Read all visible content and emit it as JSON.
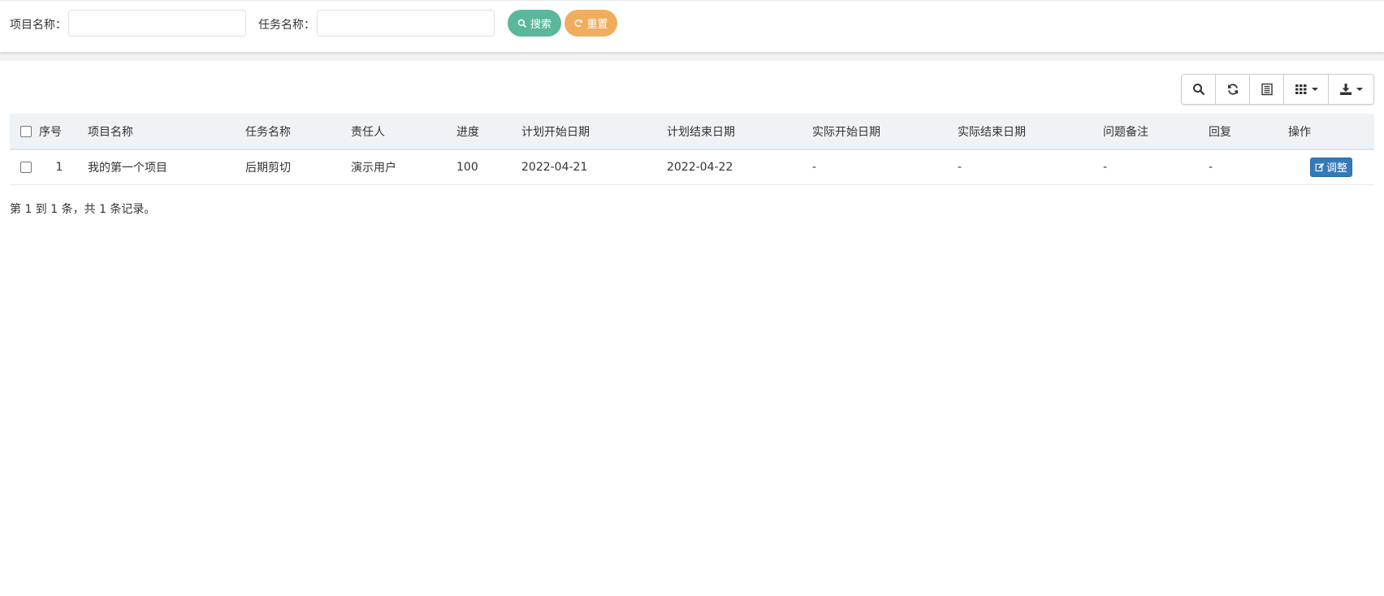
{
  "search": {
    "project_label": "项目名称：",
    "project_value": "",
    "task_label": "任务名称：",
    "task_value": "",
    "search_button": "搜索",
    "reset_button": "重置"
  },
  "toolbar": {
    "icons": [
      "search-icon",
      "refresh-icon",
      "toggle-view-icon",
      "columns-icon",
      "export-icon"
    ]
  },
  "table": {
    "headers": {
      "seq": "序号",
      "project": "项目名称",
      "task": "任务名称",
      "owner": "责任人",
      "progress": "进度",
      "plan_start": "计划开始日期",
      "plan_end": "计划结束日期",
      "actual_start": "实际开始日期",
      "actual_end": "实际结束日期",
      "remark": "问题备注",
      "reply": "回复",
      "actions": "操作"
    },
    "rows": [
      {
        "seq": "1",
        "project": "我的第一个项目",
        "task": "后期剪切",
        "owner": "演示用户",
        "progress": "100",
        "plan_start": "2022-04-21",
        "plan_end": "2022-04-22",
        "actual_start": "-",
        "actual_end": "-",
        "remark": "-",
        "reply": "-",
        "action_label": "调整"
      }
    ]
  },
  "pagination": {
    "info": "第 1 到 1 条，共 1 条记录。"
  },
  "colors": {
    "search_button": "#5bb79c",
    "reset_button": "#f0ad5e",
    "adjust_button": "#337ab7",
    "header_bg": "#eff3f8"
  }
}
